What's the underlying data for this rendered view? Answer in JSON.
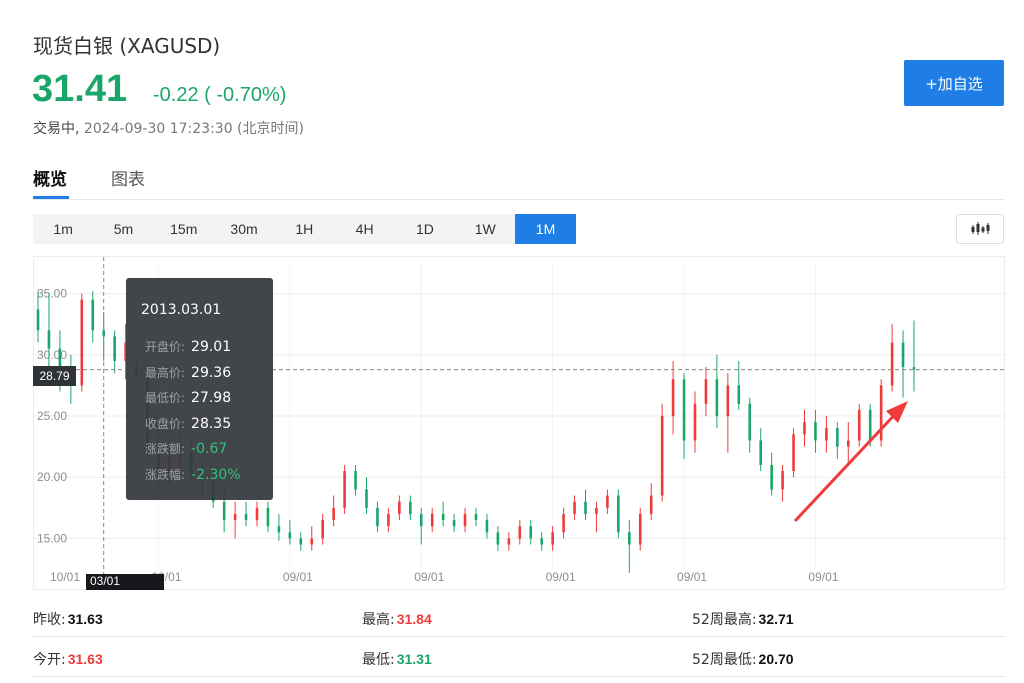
{
  "header": {
    "title": "现货白银 (XAGUSD)",
    "price": "31.41",
    "change": "-0.22 ( -0.70%)",
    "status_label": "交易中,",
    "timestamp": "2024-09-30 17:23:30 (北京时间)",
    "watch_button": "+加自选"
  },
  "colors": {
    "up": "#ee3b3b",
    "down": "#1aa66b",
    "accent": "#1e7ee6",
    "arrow": "#ee3b3b"
  },
  "tabs": [
    {
      "label": "概览",
      "active": true
    },
    {
      "label": "图表",
      "active": false
    }
  ],
  "periods": [
    {
      "label": "1m",
      "active": false
    },
    {
      "label": "5m",
      "active": false
    },
    {
      "label": "15m",
      "active": false
    },
    {
      "label": "30m",
      "active": false
    },
    {
      "label": "1H",
      "active": false
    },
    {
      "label": "4H",
      "active": false
    },
    {
      "label": "1D",
      "active": false
    },
    {
      "label": "1W",
      "active": false
    },
    {
      "label": "1M",
      "active": true
    }
  ],
  "chart_type_icon": "candlestick-icon",
  "tooltip": {
    "date": "2013.03.01",
    "rows": [
      {
        "label": "开盘价:",
        "value": "29.01",
        "tone": "neutral"
      },
      {
        "label": "最高价:",
        "value": "29.36",
        "tone": "neutral"
      },
      {
        "label": "最低价:",
        "value": "27.98",
        "tone": "neutral"
      },
      {
        "label": "收盘价:",
        "value": "28.35",
        "tone": "neutral"
      },
      {
        "label": "涨跌额:",
        "value": "-0.67",
        "tone": "down"
      },
      {
        "label": "涨跌幅:",
        "value": "-2.30%",
        "tone": "down"
      }
    ]
  },
  "crosshair": {
    "price_label": "28.79",
    "date_label": "03/01"
  },
  "chart_data": {
    "type": "candlestick",
    "title": "",
    "ylim": [
      12.5,
      37.5
    ],
    "y_ticks": [
      "35.00",
      "30.00",
      "25.00",
      "20.00",
      "15.00"
    ],
    "y_tick_values": [
      35,
      30,
      25,
      20,
      15
    ],
    "x_ticks": [
      "10/01",
      "09/01",
      "09/01",
      "09/01",
      "09/01",
      "09/01",
      "09/01"
    ],
    "x_tick_indices": [
      0,
      11,
      23,
      35,
      47,
      59,
      71
    ],
    "grid": true,
    "crosshair_value": 28.79,
    "crosshair_index": 6,
    "candles": [
      [
        33.7,
        35.2,
        31.0,
        32.0
      ],
      [
        32.0,
        35.0,
        28.5,
        30.5
      ],
      [
        30.5,
        32.0,
        27.0,
        28.0
      ],
      [
        28.0,
        30.0,
        26.0,
        27.5
      ],
      [
        27.5,
        35.0,
        27.0,
        34.5
      ],
      [
        34.5,
        35.2,
        31.0,
        32.0
      ],
      [
        32.0,
        33.5,
        29.5,
        31.5
      ],
      [
        31.5,
        32.0,
        28.5,
        29.5
      ],
      [
        29.5,
        32.5,
        28.0,
        31.0
      ],
      [
        29.01,
        29.36,
        27.98,
        28.35
      ],
      [
        28.35,
        28.8,
        22.0,
        22.5
      ],
      [
        22.5,
        24.0,
        19.0,
        20.0
      ],
      [
        20.0,
        22.5,
        19.5,
        21.5
      ],
      [
        21.5,
        23.5,
        20.0,
        22.0
      ],
      [
        22.0,
        23.0,
        19.5,
        20.0
      ],
      [
        20.0,
        21.0,
        18.5,
        19.5
      ],
      [
        19.5,
        20.5,
        17.5,
        18.0
      ],
      [
        18.0,
        19.0,
        15.5,
        16.5
      ],
      [
        16.5,
        18.0,
        15.0,
        17.0
      ],
      [
        17.0,
        18.0,
        16.0,
        16.5
      ],
      [
        16.5,
        18.0,
        16.0,
        17.5
      ],
      [
        17.5,
        18.0,
        15.5,
        16.0
      ],
      [
        16.0,
        17.0,
        14.8,
        15.5
      ],
      [
        15.5,
        16.5,
        14.5,
        15.0
      ],
      [
        15.0,
        15.5,
        14.0,
        14.5
      ],
      [
        14.5,
        16.0,
        14.0,
        15.0
      ],
      [
        15.0,
        17.0,
        14.5,
        16.5
      ],
      [
        16.5,
        18.5,
        16.0,
        17.5
      ],
      [
        17.5,
        21.0,
        17.0,
        20.5
      ],
      [
        20.5,
        21.0,
        18.5,
        19.0
      ],
      [
        19.0,
        20.0,
        17.0,
        17.5
      ],
      [
        17.5,
        18.0,
        15.5,
        16.0
      ],
      [
        16.0,
        17.5,
        15.5,
        17.0
      ],
      [
        17.0,
        18.5,
        16.5,
        18.0
      ],
      [
        18.0,
        18.5,
        16.5,
        17.0
      ],
      [
        17.0,
        17.5,
        14.5,
        16.0
      ],
      [
        16.0,
        17.5,
        15.5,
        17.0
      ],
      [
        17.0,
        18.0,
        16.0,
        16.5
      ],
      [
        16.5,
        17.0,
        15.5,
        16.0
      ],
      [
        16.0,
        17.5,
        15.5,
        17.0
      ],
      [
        17.0,
        17.5,
        16.0,
        16.5
      ],
      [
        16.5,
        17.0,
        15.0,
        15.5
      ],
      [
        15.5,
        16.0,
        14.0,
        14.5
      ],
      [
        14.5,
        15.5,
        14.0,
        15.0
      ],
      [
        15.0,
        16.5,
        14.5,
        16.0
      ],
      [
        16.0,
        16.5,
        14.5,
        15.0
      ],
      [
        15.0,
        15.5,
        14.0,
        14.5
      ],
      [
        14.5,
        16.0,
        14.0,
        15.5
      ],
      [
        15.5,
        17.5,
        15.0,
        17.0
      ],
      [
        17.0,
        18.5,
        16.5,
        18.0
      ],
      [
        18.0,
        19.0,
        16.5,
        17.0
      ],
      [
        17.0,
        18.0,
        15.5,
        17.5
      ],
      [
        17.5,
        19.0,
        17.0,
        18.5
      ],
      [
        18.5,
        19.0,
        15.0,
        15.5
      ],
      [
        15.5,
        16.5,
        12.2,
        14.5
      ],
      [
        14.5,
        17.5,
        14.0,
        17.0
      ],
      [
        17.0,
        19.5,
        16.5,
        18.5
      ],
      [
        18.5,
        26.0,
        18.0,
        25.0
      ],
      [
        25.0,
        29.5,
        23.5,
        28.0
      ],
      [
        28.0,
        28.5,
        21.5,
        23.0
      ],
      [
        23.0,
        27.0,
        22.0,
        26.0
      ],
      [
        26.0,
        29.0,
        25.0,
        28.0
      ],
      [
        28.0,
        30.0,
        24.0,
        25.0
      ],
      [
        25.0,
        28.5,
        22.0,
        27.5
      ],
      [
        27.5,
        29.5,
        25.5,
        26.0
      ],
      [
        26.0,
        26.5,
        22.0,
        23.0
      ],
      [
        23.0,
        24.0,
        20.5,
        21.0
      ],
      [
        21.0,
        22.0,
        18.5,
        19.0
      ],
      [
        19.0,
        21.0,
        18.0,
        20.5
      ],
      [
        20.5,
        24.0,
        20.0,
        23.5
      ],
      [
        23.5,
        25.5,
        22.5,
        24.5
      ],
      [
        24.5,
        25.5,
        22.0,
        23.0
      ],
      [
        23.0,
        25.0,
        22.0,
        24.0
      ],
      [
        24.0,
        24.5,
        21.5,
        22.5
      ],
      [
        22.5,
        24.5,
        21.0,
        23.0
      ],
      [
        23.0,
        26.0,
        22.5,
        25.5
      ],
      [
        25.5,
        26.0,
        22.5,
        23.0
      ],
      [
        23.0,
        28.0,
        22.5,
        27.5
      ],
      [
        27.5,
        32.5,
        27.0,
        31.0
      ],
      [
        31.0,
        32.0,
        26.5,
        29.0
      ],
      [
        29.0,
        32.8,
        27.0,
        28.8
      ]
    ]
  },
  "stats": [
    [
      {
        "label": "昨收:",
        "value": "31.63",
        "tone": "dark"
      },
      {
        "label": "最高:",
        "value": "31.84",
        "tone": "red"
      },
      {
        "label": "52周最高:",
        "value": "32.71",
        "tone": "dark"
      }
    ],
    [
      {
        "label": "今开:",
        "value": "31.63",
        "tone": "red"
      },
      {
        "label": "最低:",
        "value": "31.31",
        "tone": "green"
      },
      {
        "label": "52周最低:",
        "value": "20.70",
        "tone": "dark"
      }
    ]
  ]
}
